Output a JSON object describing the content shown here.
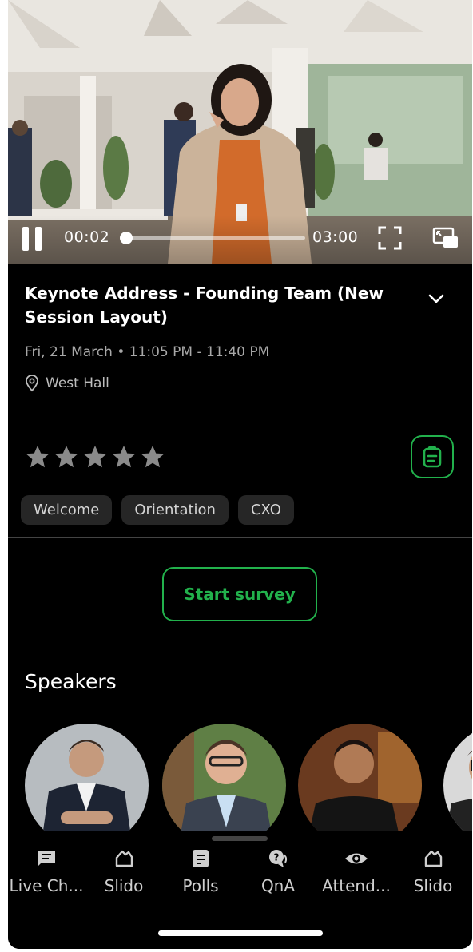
{
  "video": {
    "current_time": "00:02",
    "duration": "03:00",
    "progress": 0.011
  },
  "session": {
    "title": "Keynote Address - Founding Team (New Session Layout)",
    "date_time": "Fri, 21 March • 11:05 PM - 11:40 PM",
    "location": "West Hall",
    "rating": 0,
    "rating_max": 5
  },
  "tags": [
    "Welcome",
    "Orientation",
    "CXO"
  ],
  "survey": {
    "label": "Start survey"
  },
  "speakers": {
    "heading": "Speakers"
  },
  "nav": [
    {
      "label": "Live Ch...",
      "icon": "chat-icon"
    },
    {
      "label": "Slido",
      "icon": "slido-icon"
    },
    {
      "label": "Polls",
      "icon": "polls-icon"
    },
    {
      "label": "QnA",
      "icon": "qna-icon"
    },
    {
      "label": "Attend...",
      "icon": "eye-icon"
    },
    {
      "label": "Slido",
      "icon": "slido-icon"
    }
  ],
  "colors": {
    "accent": "#22b14c",
    "background": "#000000",
    "tag_bg": "#262626",
    "star_empty": "#8a8a8a"
  }
}
